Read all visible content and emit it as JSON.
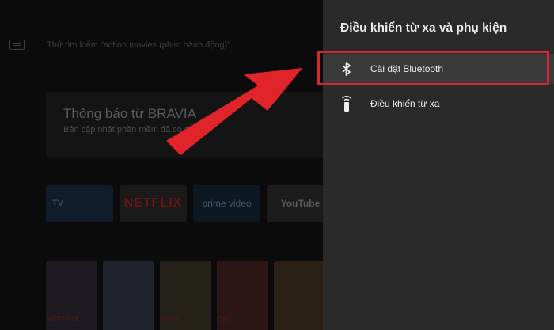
{
  "home": {
    "search_placeholder": "Thử tìm kiếm \"action movies (phim hành động)\"",
    "notification_title": "Thông báo từ BRAVIA",
    "notification_sub": "Bản cập nhật phần mềm đã có sẵn",
    "apps": [
      "TV",
      "NETFLIX",
      "prime video",
      "YouTube"
    ],
    "row_labels": [
      "NETFLIX",
      "",
      "lip tv",
      "ON",
      ""
    ]
  },
  "panel": {
    "title": "Điều khiển từ xa và phụ kiện",
    "items": [
      {
        "label": "Cài đặt Bluetooth",
        "icon": "bluetooth-icon"
      },
      {
        "label": "Điều khiển từ xa",
        "icon": "remote-icon"
      }
    ]
  },
  "colors": {
    "highlight": "#d8262c",
    "panel_bg": "#2a2a2a"
  }
}
